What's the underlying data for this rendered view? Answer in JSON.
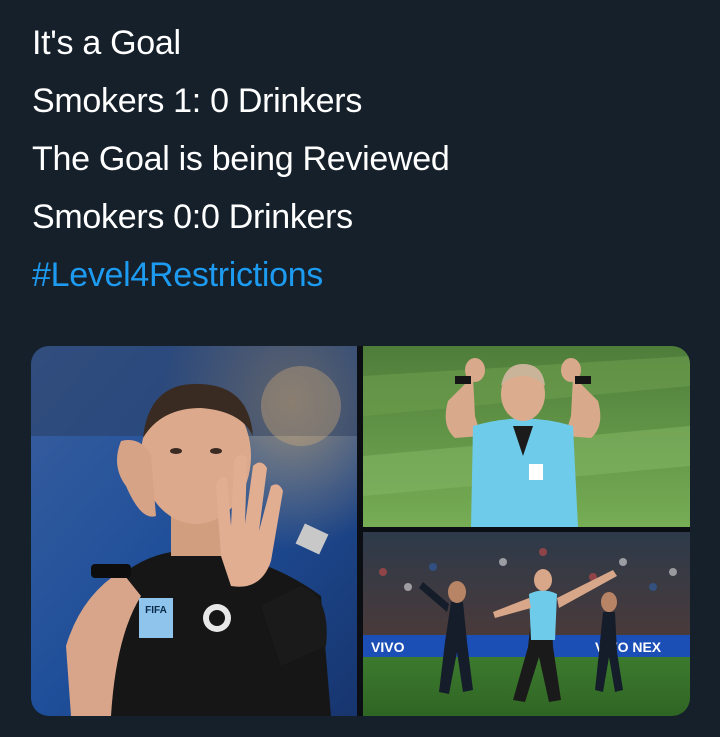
{
  "tweet": {
    "lines": [
      "It's a Goal",
      "Smokers 1: 0 Drinkers",
      "The Goal is being Reviewed",
      "Smokers 0:0 Drinkers"
    ],
    "hashtag": "#Level4Restrictions"
  },
  "media": {
    "photos": [
      {
        "subject": "Referee in black kit holding hand up to ear and raising open palm",
        "badge_text": "FIFA"
      },
      {
        "subject": "Referee in light blue kit drawing a VAR screen shape with both hands above head"
      },
      {
        "subject": "Referee in light blue kit drawing a VAR screen shape in front of players",
        "adboard_text": "VIVO NEX",
        "adboard_left": "VIVO"
      }
    ]
  },
  "colors": {
    "background": "#15202b",
    "text": "#ffffff",
    "hashtag": "#1d9bf0"
  }
}
